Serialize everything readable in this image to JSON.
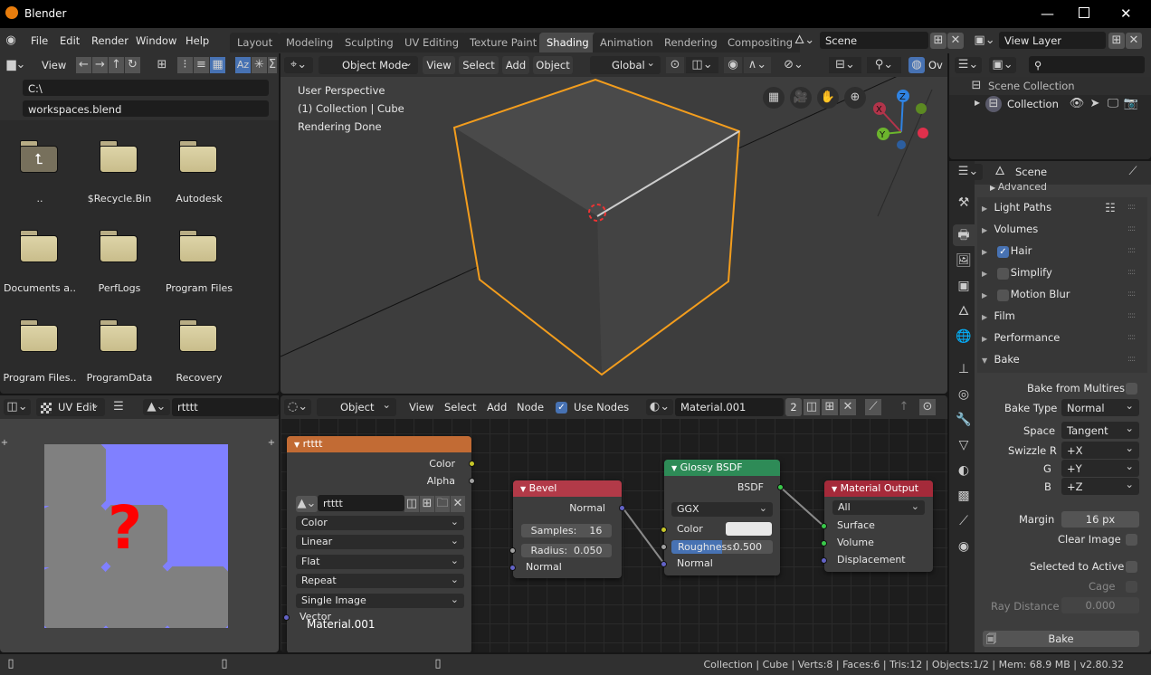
{
  "window": {
    "title": "Blender",
    "controls": [
      "minimize-icon",
      "maximize-icon",
      "close-icon"
    ]
  },
  "menubar": {
    "items": [
      "File",
      "Edit",
      "Render",
      "Window",
      "Help"
    ]
  },
  "workspaces": {
    "tabs": [
      "Layout",
      "Modeling",
      "Sculpting",
      "UV Editing",
      "Texture Paint",
      "Shading",
      "Animation",
      "Rendering",
      "Compositing"
    ],
    "active": "Shading"
  },
  "scene_selector": {
    "value": "Scene"
  },
  "view_layer_selector": {
    "value": "View Layer"
  },
  "file_browser": {
    "view_label": "View",
    "path": "C:\\",
    "filename": "workspaces.blend",
    "items": [
      {
        "name": "..",
        "type": "parent"
      },
      {
        "name": "$Recycle.Bin",
        "type": "folder"
      },
      {
        "name": "Autodesk",
        "type": "folder"
      },
      {
        "name": "Documents a..",
        "type": "folder"
      },
      {
        "name": "PerfLogs",
        "type": "folder"
      },
      {
        "name": "Program Files",
        "type": "folder"
      },
      {
        "name": "Program Files..",
        "type": "folder"
      },
      {
        "name": "ProgramData",
        "type": "folder"
      },
      {
        "name": "Recovery",
        "type": "folder"
      }
    ]
  },
  "viewport": {
    "mode": "Object Mode",
    "menus": [
      "View",
      "Select",
      "Add",
      "Object"
    ],
    "orientation": "Global",
    "overlay_label": "Ov",
    "info": [
      "User Perspective",
      "(1) Collection | Cube",
      "Rendering Done"
    ],
    "gizmo_axes": [
      "X",
      "Y",
      "Z"
    ]
  },
  "outliner": {
    "scene_collection": "Scene Collection",
    "collection": "Collection"
  },
  "properties": {
    "context": "Scene",
    "advanced_label": "Advanced",
    "panels": [
      {
        "label": "Light Paths",
        "expanded": false
      },
      {
        "label": "Volumes",
        "expanded": false
      },
      {
        "label": "Hair",
        "expanded": false,
        "checkbox": true
      },
      {
        "label": "Simplify",
        "expanded": false,
        "checkbox": false
      },
      {
        "label": "Motion Blur",
        "expanded": false,
        "checkbox": false
      },
      {
        "label": "Film",
        "expanded": false
      },
      {
        "label": "Performance",
        "expanded": false
      },
      {
        "label": "Bake",
        "expanded": true
      }
    ],
    "bake": {
      "bake_from_multires": {
        "label": "Bake from Multires",
        "checked": false
      },
      "bake_type": {
        "label": "Bake Type",
        "value": "Normal"
      },
      "space": {
        "label": "Space",
        "value": "Tangent"
      },
      "swizzle_r": {
        "label": "Swizzle R",
        "value": "+X"
      },
      "swizzle_g": {
        "label": "G",
        "value": "+Y"
      },
      "swizzle_b": {
        "label": "B",
        "value": "+Z"
      },
      "margin": {
        "label": "Margin",
        "value": "16 px"
      },
      "clear_image": {
        "label": "Clear Image",
        "checked": false
      },
      "selected_to_active": {
        "label": "Selected to Active",
        "checked": false
      },
      "cage": {
        "label": "Cage",
        "checked": false
      },
      "ray_distance": {
        "label": "Ray Distance",
        "value": "0.000"
      },
      "bake_button": "Bake"
    }
  },
  "uv_editor": {
    "mode": "UV Edit",
    "image_name": "rtttt"
  },
  "node_editor": {
    "type": "Object",
    "menus": [
      "View",
      "Select",
      "Add",
      "Node"
    ],
    "use_nodes": {
      "label": "Use Nodes",
      "checked": true
    },
    "material": "Material.001",
    "users": "2",
    "footer_label": "Material.001",
    "nodes": {
      "image": {
        "title": "rtttt",
        "outputs": [
          "Color",
          "Alpha"
        ],
        "image": "rtttt",
        "color_space": "Color",
        "interpolation": "Linear",
        "projection": "Flat",
        "extension": "Repeat",
        "source": "Single Image",
        "input": "Vector",
        "header_color": "#c26b34"
      },
      "bevel": {
        "title": "Bevel",
        "output": "Normal",
        "samples_label": "Samples:",
        "samples": "16",
        "radius_label": "Radius:",
        "radius": "0.050",
        "input": "Normal",
        "header_color": "#b23a48"
      },
      "glossy": {
        "title": "Glossy BSDF",
        "output": "BSDF",
        "distribution": "GGX",
        "color_label": "Color",
        "roughness_label": "Roughness:",
        "roughness": "0.500",
        "roughness_fraction": 0.5,
        "normal_label": "Normal",
        "header_color": "#2e8b57"
      },
      "output": {
        "title": "Material Output",
        "target": "All",
        "inputs": [
          "Surface",
          "Volume",
          "Displacement"
        ],
        "header_color": "#a52a3a"
      }
    }
  },
  "statusbar": {
    "text": "Collection | Cube | Verts:8 | Faces:6 | Tris:12 | Objects:1/2 | Mem: 68.9 MB | v2.80.32"
  }
}
